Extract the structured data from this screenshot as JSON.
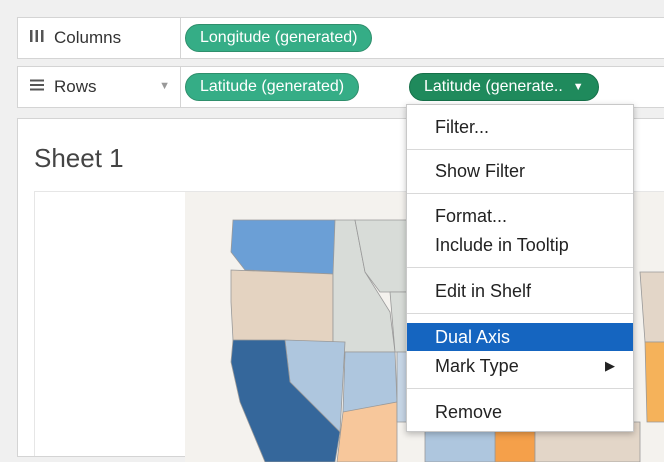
{
  "shelves": {
    "columns": {
      "label": "Columns",
      "icon": "columns-icon",
      "pills": [
        "Longitude (generated)"
      ]
    },
    "rows": {
      "label": "Rows",
      "icon": "rows-icon",
      "pills": [
        "Latitude (generated)",
        "Latitude (generate.."
      ]
    }
  },
  "sheet": {
    "title": "Sheet 1"
  },
  "context_menu": {
    "items": [
      {
        "label": "Filter..."
      },
      {
        "label": "Show Filter"
      },
      {
        "label": "Format..."
      },
      {
        "label": "Include in Tooltip"
      },
      {
        "label": "Edit in Shelf"
      },
      {
        "label": "Dual Axis",
        "highlighted": true
      },
      {
        "label": "Mark Type",
        "submenu": true
      },
      {
        "label": "Remove"
      }
    ]
  },
  "colors": {
    "pill": "#35ad86",
    "pill_active": "#1f8a5c",
    "menu_highlight": "#1565c0"
  }
}
